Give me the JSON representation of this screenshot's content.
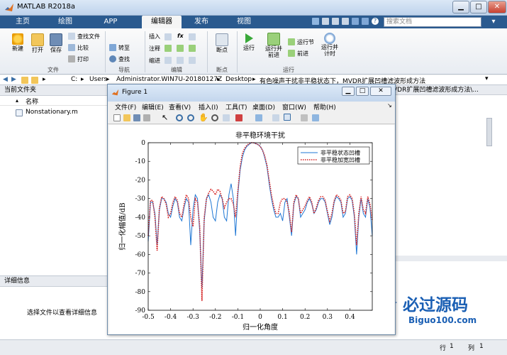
{
  "app": {
    "title": "MATLAB R2018a"
  },
  "ribbon": {
    "tabs": [
      "主页",
      "绘图",
      "APP",
      "编辑器",
      "发布",
      "视图"
    ],
    "active_tab": "编辑器",
    "search_placeholder": "搜索文档",
    "file": {
      "new": "新建",
      "open": "打开",
      "save": "保存",
      "find_files": "查找文件",
      "compare": "比较",
      "print": "打印",
      "group": "文件"
    },
    "nav": {
      "goto": "转至",
      "find": "查找",
      "group": "导航"
    },
    "edit": {
      "insert": "插入",
      "comment": "注释",
      "indent": "缩进",
      "fx": "fx",
      "group": "编辑"
    },
    "breakpoints": {
      "label": "断点",
      "group": "断点"
    },
    "run": {
      "run": "运行",
      "run_advance": "运行并\n前进",
      "run_section": "运行节",
      "advance": "前进",
      "run_time": "运行并\n计时",
      "group": "运行"
    }
  },
  "address": {
    "path": [
      "C:",
      "Users",
      "Administrator.WIN7U-20180127Z",
      "Desktop",
      "有色噪声干扰非平稳状态下，MVDR扩展凹槽滤波形成方法"
    ]
  },
  "left_panel": {
    "header": "当前文件夹",
    "col_name": "名称",
    "files": [
      "Nonstationary.m"
    ],
    "detail_header": "详细信息",
    "detail_msg": "选择文件以查看详细信息"
  },
  "cmd_header": "VDR扩展凹槽滤波形成方法\\...",
  "status": {
    "row_label": "行",
    "row_value": "1",
    "col_label": "列",
    "col_value": "1"
  },
  "watermark": {
    "line1": "必过源码",
    "line2": "Biguo100.com"
  },
  "figure": {
    "title": "Figure 1",
    "menu": [
      "文件(F)",
      "编辑(E)",
      "查看(V)",
      "插入(I)",
      "工具(T)",
      "桌面(D)",
      "窗口(W)",
      "帮助(H)"
    ]
  },
  "chart_data": {
    "type": "line",
    "title": "非平稳环境干扰",
    "xlabel": "归一化角度",
    "ylabel": "归一化幅值/dB",
    "xlim": [
      -0.5,
      0.5
    ],
    "ylim": [
      -90,
      0
    ],
    "xticks": [
      "-0.5",
      "-0.4",
      "-0.3",
      "-0.2",
      "-0.1",
      "0",
      "0.1",
      "0.2",
      "0.3",
      "0.4"
    ],
    "yticks": [
      "0",
      "-10",
      "-20",
      "-30",
      "-40",
      "-50",
      "-60",
      "-70",
      "-80",
      "-90"
    ],
    "legend": "top-right",
    "series": [
      {
        "name": "非平稳状态凹槽",
        "color": "#1f77d4",
        "style": "solid",
        "x": [
          -0.5,
          -0.49,
          -0.48,
          -0.47,
          -0.46,
          -0.45,
          -0.44,
          -0.43,
          -0.42,
          -0.41,
          -0.4,
          -0.39,
          -0.38,
          -0.37,
          -0.36,
          -0.35,
          -0.34,
          -0.33,
          -0.32,
          -0.31,
          -0.3,
          -0.29,
          -0.28,
          -0.27,
          -0.26,
          -0.25,
          -0.24,
          -0.23,
          -0.22,
          -0.21,
          -0.2,
          -0.19,
          -0.18,
          -0.17,
          -0.16,
          -0.15,
          -0.14,
          -0.13,
          -0.12,
          -0.11,
          -0.1,
          -0.09,
          -0.08,
          -0.07,
          -0.06,
          -0.05,
          -0.04,
          -0.03,
          -0.02,
          -0.01,
          0,
          0.01,
          0.02,
          0.03,
          0.04,
          0.05,
          0.06,
          0.07,
          0.08,
          0.09,
          0.1,
          0.11,
          0.12,
          0.13,
          0.14,
          0.15,
          0.16,
          0.17,
          0.18,
          0.19,
          0.2,
          0.21,
          0.22,
          0.23,
          0.24,
          0.25,
          0.26,
          0.27,
          0.28,
          0.29,
          0.3,
          0.31,
          0.32,
          0.33,
          0.34,
          0.35,
          0.36,
          0.37,
          0.38,
          0.39,
          0.4,
          0.41,
          0.42,
          0.43,
          0.44,
          0.45,
          0.46,
          0.47,
          0.48,
          0.49,
          0.5
        ],
        "y": [
          -53,
          -32,
          -32,
          -38,
          -55,
          -36,
          -30,
          -30,
          -32,
          -38,
          -40,
          -34,
          -30,
          -32,
          -40,
          -42,
          -35,
          -30,
          -32,
          -55,
          -36,
          -28,
          -30,
          -48,
          -78,
          -42,
          -30,
          -28,
          -32,
          -40,
          -42,
          -32,
          -28,
          -30,
          -40,
          -42,
          -28,
          -22,
          -30,
          -50,
          -28,
          -15,
          -8,
          -4,
          -2,
          -1,
          0,
          0,
          -0.5,
          -1,
          -2,
          -4,
          -8,
          -13,
          -22,
          -30,
          -36,
          -40,
          -40,
          -38,
          -42,
          -32,
          -30,
          -40,
          -50,
          -33,
          -29,
          -30,
          -40,
          -38,
          -36,
          -32,
          -30,
          -33,
          -38,
          -36,
          -32,
          -30,
          -30,
          -32,
          -38,
          -44,
          -40,
          -32,
          -29,
          -30,
          -32,
          -40,
          -38,
          -30,
          -29,
          -31,
          -40,
          -60,
          -40,
          -30,
          -38,
          -40,
          -30,
          -35,
          -50
        ]
      },
      {
        "name": "非平稳加宽凹槽",
        "color": "#d41f1f",
        "style": "dotted",
        "x": [
          -0.5,
          -0.49,
          -0.48,
          -0.47,
          -0.46,
          -0.45,
          -0.44,
          -0.43,
          -0.42,
          -0.41,
          -0.4,
          -0.39,
          -0.38,
          -0.37,
          -0.36,
          -0.35,
          -0.34,
          -0.33,
          -0.32,
          -0.31,
          -0.3,
          -0.29,
          -0.28,
          -0.27,
          -0.26,
          -0.25,
          -0.24,
          -0.23,
          -0.22,
          -0.21,
          -0.2,
          -0.19,
          -0.18,
          -0.17,
          -0.16,
          -0.15,
          -0.14,
          -0.13,
          -0.12,
          -0.11,
          -0.1,
          -0.09,
          -0.08,
          -0.07,
          -0.06,
          -0.05,
          -0.04,
          -0.03,
          -0.02,
          -0.01,
          0,
          0.01,
          0.02,
          0.03,
          0.04,
          0.05,
          0.06,
          0.07,
          0.08,
          0.09,
          0.1,
          0.11,
          0.12,
          0.13,
          0.14,
          0.15,
          0.16,
          0.17,
          0.18,
          0.19,
          0.2,
          0.21,
          0.22,
          0.23,
          0.24,
          0.25,
          0.26,
          0.27,
          0.28,
          0.29,
          0.3,
          0.31,
          0.32,
          0.33,
          0.34,
          0.35,
          0.36,
          0.37,
          0.38,
          0.39,
          0.4,
          0.41,
          0.42,
          0.43,
          0.44,
          0.45,
          0.46,
          0.47,
          0.48,
          0.49,
          0.5
        ],
        "y": [
          -50,
          -31,
          -31,
          -40,
          -58,
          -35,
          -29,
          -30,
          -33,
          -40,
          -38,
          -32,
          -29,
          -31,
          -38,
          -40,
          -33,
          -28,
          -30,
          -40,
          -45,
          -30,
          -32,
          -45,
          -85,
          -40,
          -30,
          -27,
          -25,
          -26,
          -28,
          -25,
          -26,
          -30,
          -35,
          -32,
          -30,
          -30,
          -33,
          -40,
          -26,
          -13,
          -6,
          -3,
          -1.5,
          -0.5,
          0,
          0,
          -0.5,
          -1,
          -2,
          -4,
          -7,
          -12,
          -20,
          -28,
          -34,
          -38,
          -38,
          -32,
          -30,
          -30,
          -32,
          -38,
          -48,
          -32,
          -28,
          -30,
          -38,
          -36,
          -34,
          -31,
          -29,
          -32,
          -38,
          -35,
          -31,
          -29,
          -29,
          -31,
          -37,
          -42,
          -38,
          -31,
          -28,
          -29,
          -31,
          -38,
          -37,
          -29,
          -28,
          -30,
          -38,
          -55,
          -38,
          -29,
          -36,
          -38,
          -29,
          -33,
          -42
        ]
      }
    ]
  }
}
